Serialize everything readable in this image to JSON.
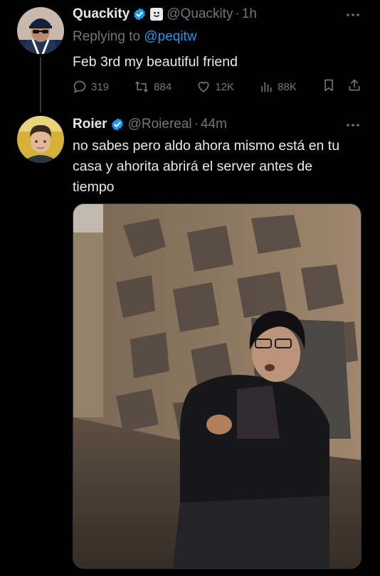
{
  "tweets": [
    {
      "name": "Quackity",
      "handle": "@Quackity",
      "time": "1h",
      "replying_prefix": "Replying to ",
      "replying_to": "@peqitw",
      "text": "Feb 3rd my beautiful friend",
      "stats": {
        "replies": "319",
        "retweets": "884",
        "likes": "12K",
        "views": "88K"
      }
    },
    {
      "name": "Roier",
      "handle": "@Roiereal",
      "time": "44m",
      "text": "no sabes pero aldo ahora mismo está en tu casa y ahorita abrirá el server antes de tiempo"
    }
  ],
  "separator": "·",
  "colors": {
    "background": "#000000",
    "text": "#e7e9ea",
    "secondary": "#71767b",
    "accent": "#1d9bf0",
    "verified": "#1d9bf0"
  },
  "icons": [
    "verified-badge-icon",
    "affiliate-badge-icon",
    "more-icon",
    "reply-icon",
    "retweet-icon",
    "like-icon",
    "views-icon",
    "bookmark-icon",
    "share-icon"
  ]
}
